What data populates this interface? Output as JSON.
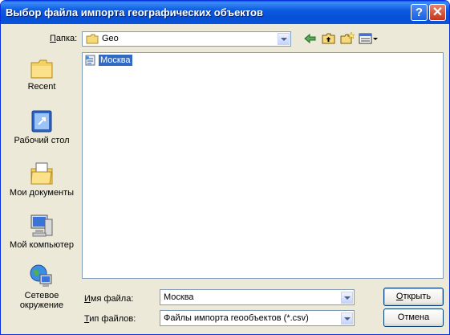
{
  "window": {
    "title": "Выбор файла импорта географических объектов",
    "help_glyph": "?",
    "close_glyph": "✕"
  },
  "lookin": {
    "label_u": "П",
    "label_rest": "апка:",
    "value": "Geo"
  },
  "places": [
    {
      "label": "Recent",
      "icon": "recent-icon"
    },
    {
      "label": "Рабочий стол",
      "icon": "desktop-icon"
    },
    {
      "label": "Мои документы",
      "icon": "my-documents-icon"
    },
    {
      "label": "Мой компьютер",
      "icon": "my-computer-icon"
    },
    {
      "label": "Сетевое окружение",
      "icon": "network-icon"
    }
  ],
  "files": [
    {
      "name": "Москва",
      "icon": "file-geo-icon",
      "selected": true
    }
  ],
  "filename": {
    "label_u": "И",
    "label_rest": "мя файла:",
    "value": "Москва"
  },
  "filetype": {
    "label_u": "Т",
    "label_rest": "ип файлов:",
    "value": "Файлы импорта геообъектов (*.csv)"
  },
  "buttons": {
    "open_u": "О",
    "open_rest": "ткрыть",
    "cancel": "Отмена"
  },
  "colors": {
    "titlebar": "#0a54d8",
    "dialog_bg": "#ece9d8",
    "selection": "#316ac5"
  }
}
